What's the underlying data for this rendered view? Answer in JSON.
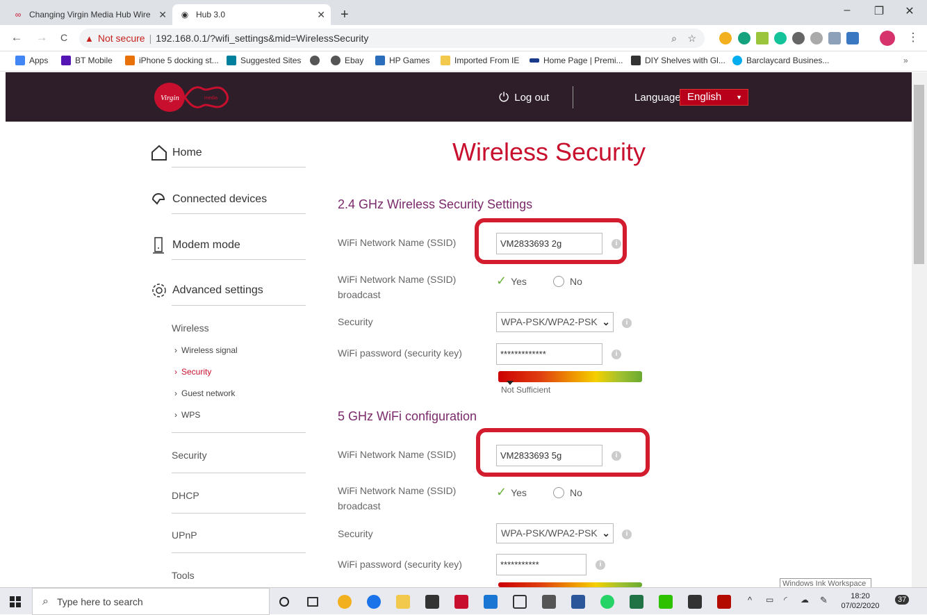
{
  "browser": {
    "tabs": [
      {
        "label": "Changing Virgin Media Hub Wire",
        "favicon": "virgin-infinity-icon"
      },
      {
        "label": "Hub 3.0",
        "favicon": "globe-icon"
      }
    ],
    "new_tab": "+",
    "window_controls": {
      "minimize": "–",
      "restore": "❐",
      "close": "✕"
    },
    "nav": {
      "back": "←",
      "forward": "→",
      "reload": "C"
    },
    "security_label": "Not secure",
    "url": "192.168.0.1/?wifi_settings&mid=WirelessSecurity",
    "bookmarks": [
      {
        "label": "Apps",
        "icon": "apps-grid-icon",
        "color": "#4285f4"
      },
      {
        "label": "BT Mobile",
        "icon": "bt-icon",
        "color": "#5514b4"
      },
      {
        "label": "iPhone 5 docking st...",
        "icon": "e-icon",
        "color": "#e8710a"
      },
      {
        "label": "Suggested Sites",
        "icon": "bing-icon",
        "color": "#00809d"
      },
      {
        "label": "",
        "icon": "globe-icon",
        "color": "#555"
      },
      {
        "label": "Ebay",
        "icon": "globe-icon",
        "color": "#555"
      },
      {
        "label": "HP Games",
        "icon": "hp-games-icon",
        "color": "#2a6ebb"
      },
      {
        "label": "Imported From IE",
        "icon": "folder-icon",
        "color": "#f2c94c"
      },
      {
        "label": "Home Page | Premi...",
        "icon": "premier-icon",
        "color": "#1a3a8a"
      },
      {
        "label": "DIY Shelves with Gl...",
        "icon": "diy-icon",
        "color": "#333"
      },
      {
        "label": "Barclaycard Busines...",
        "icon": "barclaycard-icon",
        "color": "#00aeef"
      }
    ],
    "bookmarks_more": "»"
  },
  "header": {
    "logout_label": "Log out",
    "language_label": "Language",
    "language_value": "English",
    "logo_alt": "virgin media"
  },
  "sidebar": {
    "main": [
      {
        "label": "Home",
        "icon": "home-icon"
      },
      {
        "label": "Connected devices",
        "icon": "devices-icon"
      },
      {
        "label": "Modem mode",
        "icon": "modem-icon"
      },
      {
        "label": "Advanced settings",
        "icon": "gear-icon"
      }
    ],
    "wireless_label": "Wireless",
    "wireless_items": [
      {
        "label": "Wireless signal",
        "active": false
      },
      {
        "label": "Security",
        "active": true
      },
      {
        "label": "Guest network",
        "active": false
      },
      {
        "label": "WPS",
        "active": false
      }
    ],
    "other": [
      "Security",
      "DHCP",
      "UPnP",
      "Tools"
    ]
  },
  "main": {
    "title": "Wireless Security",
    "band24": {
      "heading": "2.4 GHz Wireless Security Settings",
      "ssid_label": "WiFi Network Name (SSID)",
      "ssid_value": "VM2833693 2g",
      "broadcast_label_1": "WiFi Network Name (SSID)",
      "broadcast_label_2": "broadcast",
      "yes": "Yes",
      "no": "No",
      "security_label": "Security",
      "security_value": "WPA-PSK/WPA2-PSK",
      "password_label": "WiFi password (security key)",
      "password_value": "*************",
      "strength_text": "Not Sufficient",
      "strength_level": 0.08
    },
    "band5": {
      "heading": "5 GHz WiFi configuration",
      "ssid_label": "WiFi Network Name (SSID)",
      "ssid_value": "VM2833693 5g",
      "broadcast_label_1": "WiFi Network Name (SSID)",
      "broadcast_label_2": "broadcast",
      "yes": "Yes",
      "no": "No",
      "security_label": "Security",
      "security_value": "WPA-PSK/WPA2-PSK",
      "password_label": "WiFi password (security key)",
      "password_value": "***********"
    }
  },
  "taskbar": {
    "search_placeholder": "Type here to search",
    "time": "18:20",
    "date": "07/02/2020",
    "notifications": "37",
    "ink_tooltip": "Windows Ink Workspace"
  },
  "colors": {
    "brand": "#c8102e",
    "header_bg": "#2e1e2a",
    "section": "#7a2a6a",
    "highlight": "#d31c2d"
  }
}
